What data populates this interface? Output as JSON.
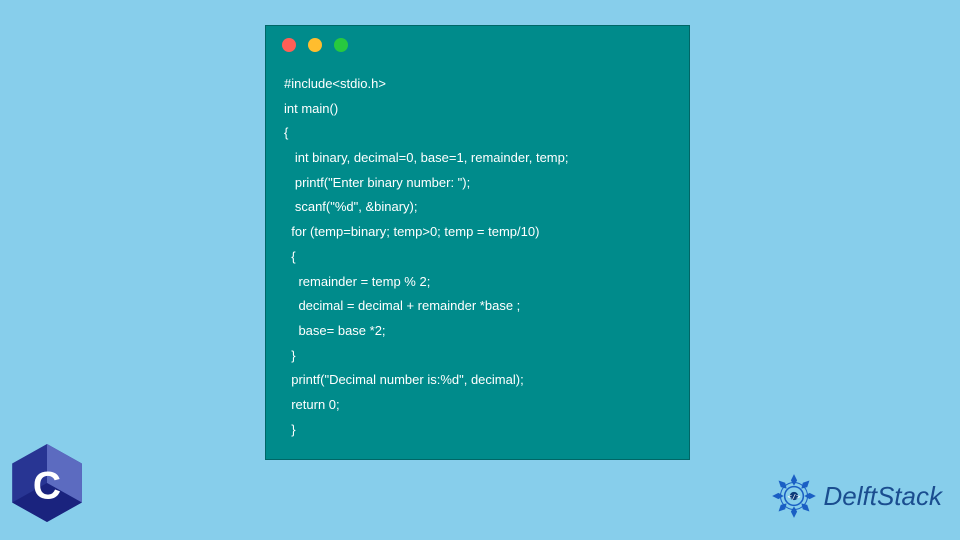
{
  "code": {
    "line1": "#include<stdio.h>",
    "line2": "int main()",
    "line3": "{",
    "line4": "   int binary, decimal=0, base=1, remainder, temp;",
    "line5": "   printf(\"Enter binary number: \");",
    "line6": "   scanf(\"%d\", &binary);",
    "line7": "  for (temp=binary; temp>0; temp = temp/10)",
    "line8": "  {",
    "line9": "    remainder = temp % 2;",
    "line10": "    decimal = decimal + remainder *base ;",
    "line11": "    base= base *2;",
    "line12": "  }",
    "line13": "  printf(\"Decimal number is:%d\", decimal);",
    "line14": "  return 0;",
    "line15": "  }"
  },
  "branding": {
    "site_name": "DelftStack"
  }
}
